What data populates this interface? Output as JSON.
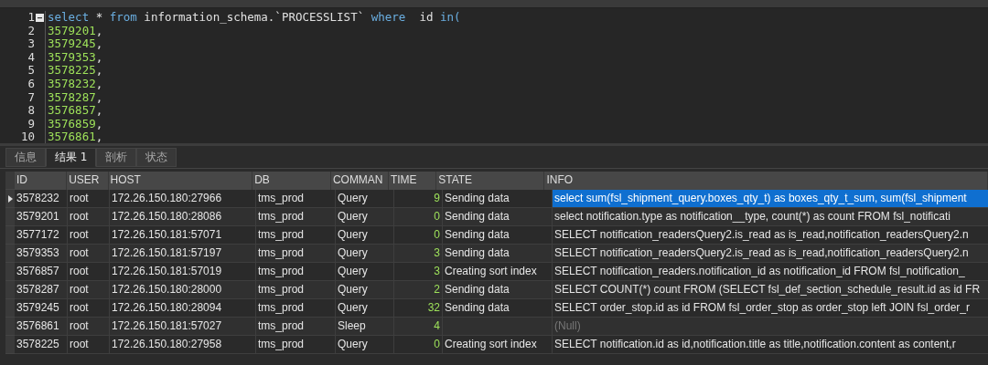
{
  "editor": {
    "lines": [
      {
        "number": "1",
        "fold": true,
        "tokens": [
          {
            "text": "select",
            "kind": "keyword"
          },
          {
            "text": " * ",
            "kind": "plain"
          },
          {
            "text": "from",
            "kind": "keyword"
          },
          {
            "text": " information_schema.`PROCESSLIST` ",
            "kind": "plain"
          },
          {
            "text": "where",
            "kind": "keyword"
          },
          {
            "text": "  id ",
            "kind": "plain"
          },
          {
            "text": "in(",
            "kind": "keyword"
          }
        ]
      },
      {
        "number": "2",
        "fold": false,
        "tokens": [
          {
            "text": "3579201",
            "kind": "number"
          },
          {
            "text": ",",
            "kind": "plain"
          }
        ]
      },
      {
        "number": "3",
        "fold": false,
        "tokens": [
          {
            "text": "3579245",
            "kind": "number"
          },
          {
            "text": ",",
            "kind": "plain"
          }
        ]
      },
      {
        "number": "4",
        "fold": false,
        "tokens": [
          {
            "text": "3579353",
            "kind": "number"
          },
          {
            "text": ",",
            "kind": "plain"
          }
        ]
      },
      {
        "number": "5",
        "fold": false,
        "tokens": [
          {
            "text": "3578225",
            "kind": "number"
          },
          {
            "text": ",",
            "kind": "plain"
          }
        ]
      },
      {
        "number": "6",
        "fold": false,
        "tokens": [
          {
            "text": "3578232",
            "kind": "number"
          },
          {
            "text": ",",
            "kind": "plain"
          }
        ]
      },
      {
        "number": "7",
        "fold": false,
        "tokens": [
          {
            "text": "3578287",
            "kind": "number"
          },
          {
            "text": ",",
            "kind": "plain"
          }
        ]
      },
      {
        "number": "8",
        "fold": false,
        "tokens": [
          {
            "text": "3576857",
            "kind": "number"
          },
          {
            "text": ",",
            "kind": "plain"
          }
        ]
      },
      {
        "number": "9",
        "fold": false,
        "tokens": [
          {
            "text": "3576859",
            "kind": "number"
          },
          {
            "text": ",",
            "kind": "plain"
          }
        ]
      },
      {
        "number": "10",
        "fold": false,
        "tokens": [
          {
            "text": "3576861",
            "kind": "number"
          },
          {
            "text": ",",
            "kind": "plain"
          }
        ]
      }
    ]
  },
  "result_tabs": [
    {
      "label": "信息",
      "selected": false
    },
    {
      "label": "结果 1",
      "selected": true
    },
    {
      "label": "剖析",
      "selected": false
    },
    {
      "label": "状态",
      "selected": false
    }
  ],
  "table": {
    "columns": [
      "ID",
      "USER",
      "HOST",
      "DB",
      "COMMAN",
      "TIME",
      "STATE",
      "INFO"
    ],
    "rows": [
      {
        "selected": true,
        "info_null": false,
        "cells": [
          "3578232",
          "root",
          "172.26.150.180:27966",
          "tms_prod",
          "Query",
          "9",
          "Sending data",
          "select sum(fsl_shipment_query.boxes_qty_t) as boxes_qty_t_sum, sum(fsl_shipment"
        ]
      },
      {
        "selected": false,
        "info_null": false,
        "cells": [
          "3579201",
          "root",
          "172.26.150.180:28086",
          "tms_prod",
          "Query",
          "0",
          "Sending data",
          "select notification.type as notification__type, count(*) as  count  FROM fsl_notificati"
        ]
      },
      {
        "selected": false,
        "info_null": false,
        "cells": [
          "3577172",
          "root",
          "172.26.150.181:57071",
          "tms_prod",
          "Query",
          "0",
          "Sending data",
          "SELECT notification_readersQuery2.is_read as is_read,notification_readersQuery2.n"
        ]
      },
      {
        "selected": false,
        "info_null": false,
        "cells": [
          "3579353",
          "root",
          "172.26.150.181:57197",
          "tms_prod",
          "Query",
          "3",
          "Sending data",
          "SELECT notification_readersQuery2.is_read as is_read,notification_readersQuery2.n"
        ]
      },
      {
        "selected": false,
        "info_null": false,
        "cells": [
          "3576857",
          "root",
          "172.26.150.181:57019",
          "tms_prod",
          "Query",
          "3",
          "Creating sort index",
          "SELECT notification_readers.notification_id as notification_id FROM fsl_notification_"
        ]
      },
      {
        "selected": false,
        "info_null": false,
        "cells": [
          "3578287",
          "root",
          "172.26.150.180:28000",
          "tms_prod",
          "Query",
          "2",
          "Sending data",
          "SELECT COUNT(*) count FROM (SELECT fsl_def_section_schedule_result.id as id FR"
        ]
      },
      {
        "selected": false,
        "info_null": false,
        "cells": [
          "3579245",
          "root",
          "172.26.150.180:28094",
          "tms_prod",
          "Query",
          "32",
          "Sending data",
          "SELECT order_stop.id as id FROM fsl_order_stop as order_stop left JOIN fsl_order_r"
        ]
      },
      {
        "selected": false,
        "info_null": true,
        "cells": [
          "3576861",
          "root",
          "172.26.150.181:57027",
          "tms_prod",
          "Sleep",
          "4",
          "",
          "(Null)"
        ]
      },
      {
        "selected": false,
        "info_null": false,
        "cells": [
          "3578225",
          "root",
          "172.26.150.180:27958",
          "tms_prod",
          "Query",
          "0",
          "Creating sort index",
          "SELECT notification.id as id,notification.title as title,notification.content as content,r"
        ]
      }
    ]
  }
}
